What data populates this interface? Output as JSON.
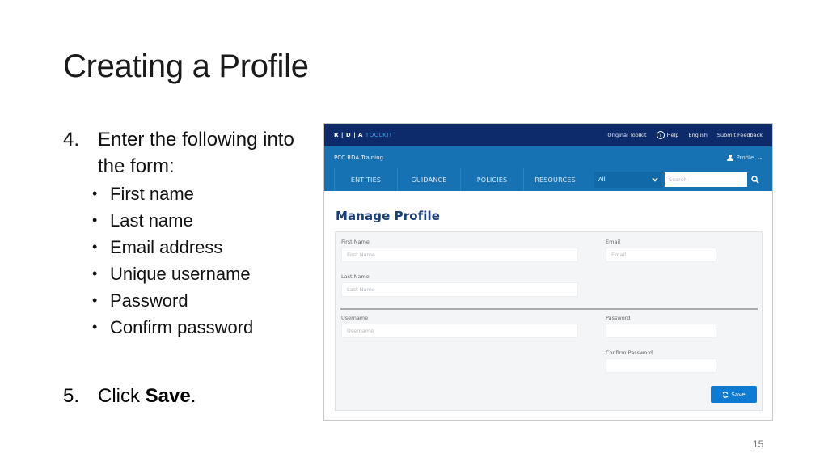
{
  "slide": {
    "title": "Creating a Profile",
    "page_number": "15"
  },
  "instructions": {
    "step4": {
      "number": "4.",
      "text": "Enter the following into the form:",
      "bullets": [
        "First name",
        "Last name",
        "Email address",
        "Unique username",
        "Password",
        "Confirm password"
      ]
    },
    "step5": {
      "number": "5.",
      "prefix": "Click ",
      "bold": "Save",
      "suffix": "."
    }
  },
  "app": {
    "topbar": {
      "brand_prefix": "R | D | A ",
      "brand_accent": "TOOLKIT",
      "links": [
        "Original Toolkit",
        "Help",
        "English",
        "Submit Feedback"
      ],
      "help_icon_glyph": "?"
    },
    "subbar": {
      "site_name": "PCC RDA Training",
      "profile_label": "Profile",
      "nav_tabs": [
        "ENTITIES",
        "GUIDANCE",
        "POLICIES",
        "RESOURCES"
      ],
      "filter_value": "All",
      "search_placeholder": "Search"
    },
    "page_heading": "Manage Profile",
    "form": {
      "first_name": {
        "label": "First Name",
        "placeholder": "First Name",
        "value": ""
      },
      "last_name": {
        "label": "Last Name",
        "placeholder": "Last Name",
        "value": ""
      },
      "email": {
        "label": "Email",
        "placeholder": "Email",
        "value": ""
      },
      "username": {
        "label": "Username",
        "placeholder": "Username",
        "value": ""
      },
      "password": {
        "label": "Password",
        "placeholder": "",
        "value": ""
      },
      "confirm_password": {
        "label": "Confirm Password",
        "placeholder": "",
        "value": ""
      },
      "save_label": "Save"
    },
    "colors": {
      "topbar": "#0d2a6b",
      "subbar": "#1672b3",
      "heading": "#1a3f7a",
      "primary_button": "#0d7bd3"
    }
  }
}
